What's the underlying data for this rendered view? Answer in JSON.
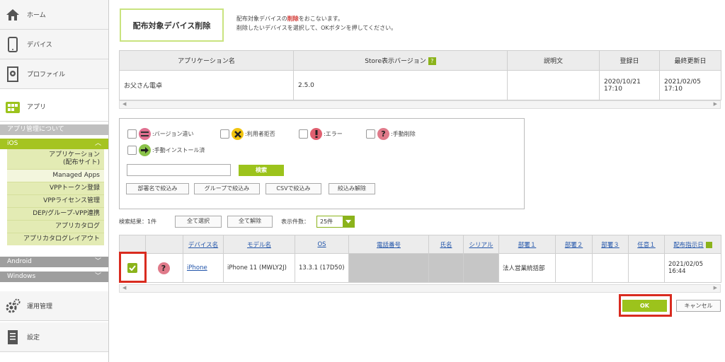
{
  "sidebar": {
    "items": [
      {
        "label": "ホーム",
        "icon": "home-icon"
      },
      {
        "label": "デバイス",
        "icon": "device-icon"
      },
      {
        "label": "プロファイル",
        "icon": "profile-icon"
      },
      {
        "label": "アプリ",
        "icon": "app-icon"
      },
      {
        "label": "運用管理",
        "icon": "gear-icon"
      },
      {
        "label": "設定",
        "icon": "settings-doc-icon"
      }
    ],
    "about_apps": "アプリ管理について",
    "ios_label": "iOS",
    "ios_items": [
      {
        "label": "アプリケーション\n(配布サイト)"
      },
      {
        "label": "Managed Apps"
      },
      {
        "label": "VPPトークン登録"
      },
      {
        "label": "VPPライセンス管理"
      },
      {
        "label": "DEP/グループ-VPP連携"
      },
      {
        "label": "アプリカタログ"
      },
      {
        "label": "アプリカタログレイアウト"
      }
    ],
    "android_label": "Android",
    "windows_label": "Windows"
  },
  "page": {
    "title": "配布対象デバイス削除",
    "desc_line1_pre": "配布対象デバイスの",
    "desc_line1_red": "削除",
    "desc_line1_post": "をおこないます。",
    "desc_line2": "削除したいデバイスを選択して、OKボタンを押してください。"
  },
  "app_table": {
    "headers": [
      "アプリケーション名",
      "Store表示バージョン",
      "説明文",
      "登録日",
      "最終更新日"
    ],
    "help_badge": "?",
    "row": {
      "name": "お父さん電卓",
      "version": "2.5.0",
      "description": "",
      "registered_date": "2020/10/21",
      "registered_time": "17:10",
      "updated_date": "2021/02/05",
      "updated_time": "17:10"
    }
  },
  "scroll": {
    "left": "◀",
    "right": "▶"
  },
  "filters": {
    "legend": [
      {
        "label": ":バージョン違い",
        "icon": "version-diff-icon",
        "color": "#e05a7a"
      },
      {
        "label": ":利用者拒否",
        "icon": "reject-icon",
        "color": "#f1c40f"
      },
      {
        "label": ":エラー",
        "icon": "error-icon",
        "color": "#e05a5a"
      },
      {
        "label": ":手動削除",
        "icon": "manual-delete-icon",
        "color": "#e07a8a"
      },
      {
        "label": ":手動インストール済",
        "icon": "manual-install-icon",
        "color": "#8bc34a"
      }
    ],
    "search_value": "",
    "search_button": "検索",
    "buttons": [
      "部署名で絞込み",
      "グループで絞込み",
      "CSVで絞込み",
      "絞込み解除"
    ]
  },
  "results": {
    "count_label": "検索結果：1件",
    "select_all": "全て選択",
    "deselect_all": "全て解除",
    "per_page_label": "表示件数：",
    "per_page_value": "25件"
  },
  "device_table": {
    "headers": [
      "デバイス名",
      "モデル名",
      "OS",
      "電話番号",
      "氏名",
      "シリアル",
      "部署１",
      "部署２",
      "部署３",
      "任意１",
      "配布指示日"
    ],
    "row": {
      "device_name": "iPhone",
      "model": "iPhone 11 (MWLY2J)",
      "os": "13.3.1 (17D50)",
      "department1": "法人営業統括部",
      "date": "2021/02/05",
      "time": "16:44"
    }
  },
  "actions": {
    "ok": "OK",
    "cancel": "キャンセル"
  },
  "colors": {
    "accent": "#9cc31c",
    "highlight": "#d92b1f"
  }
}
